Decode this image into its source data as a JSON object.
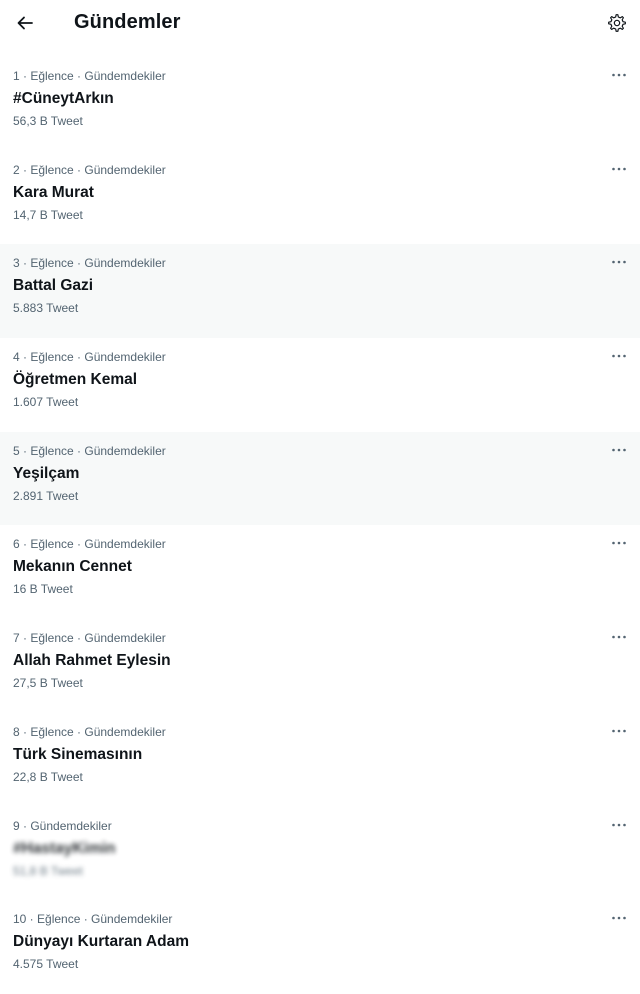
{
  "header": {
    "title": "Gündemler",
    "back_icon": "arrow-left-icon",
    "settings_icon": "gear-icon"
  },
  "trends": [
    {
      "meta": "1 · Eğlence · Gündemdekiler",
      "name": "#CüneytArkın",
      "count": "56,3 B Tweet",
      "blurred": false,
      "shaded": false
    },
    {
      "meta": "2 · Eğlence · Gündemdekiler",
      "name": "Kara Murat",
      "count": "14,7 B Tweet",
      "blurred": false,
      "shaded": false
    },
    {
      "meta": "3 · Eğlence · Gündemdekiler",
      "name": "Battal Gazi",
      "count": "5.883 Tweet",
      "blurred": false,
      "shaded": true
    },
    {
      "meta": "4 · Eğlence · Gündemdekiler",
      "name": "Öğretmen Kemal",
      "count": "1.607 Tweet",
      "blurred": false,
      "shaded": false
    },
    {
      "meta": "5 · Eğlence · Gündemdekiler",
      "name": "Yeşilçam",
      "count": "2.891 Tweet",
      "blurred": false,
      "shaded": true
    },
    {
      "meta": "6 · Eğlence · Gündemdekiler",
      "name": "Mekanın Cennet",
      "count": "16 B Tweet",
      "blurred": false,
      "shaded": false
    },
    {
      "meta": "7 · Eğlence · Gündemdekiler",
      "name": "Allah Rahmet Eylesin",
      "count": "27,5 B Tweet",
      "blurred": false,
      "shaded": false
    },
    {
      "meta": "8 · Eğlence · Gündemdekiler",
      "name": "Türk Sinemasının",
      "count": "22,8 B Tweet",
      "blurred": false,
      "shaded": false
    },
    {
      "meta": "9 · Gündemdekiler",
      "name": "#HastayKimin",
      "count": "51,8 B Tweet",
      "blurred": true,
      "shaded": false
    },
    {
      "meta": "10 · Eğlence · Gündemdekiler",
      "name": "Dünyayı Kurtaran Adam",
      "count": "4.575 Tweet",
      "blurred": false,
      "shaded": false
    }
  ],
  "more_icon": "more-horizontal-icon"
}
